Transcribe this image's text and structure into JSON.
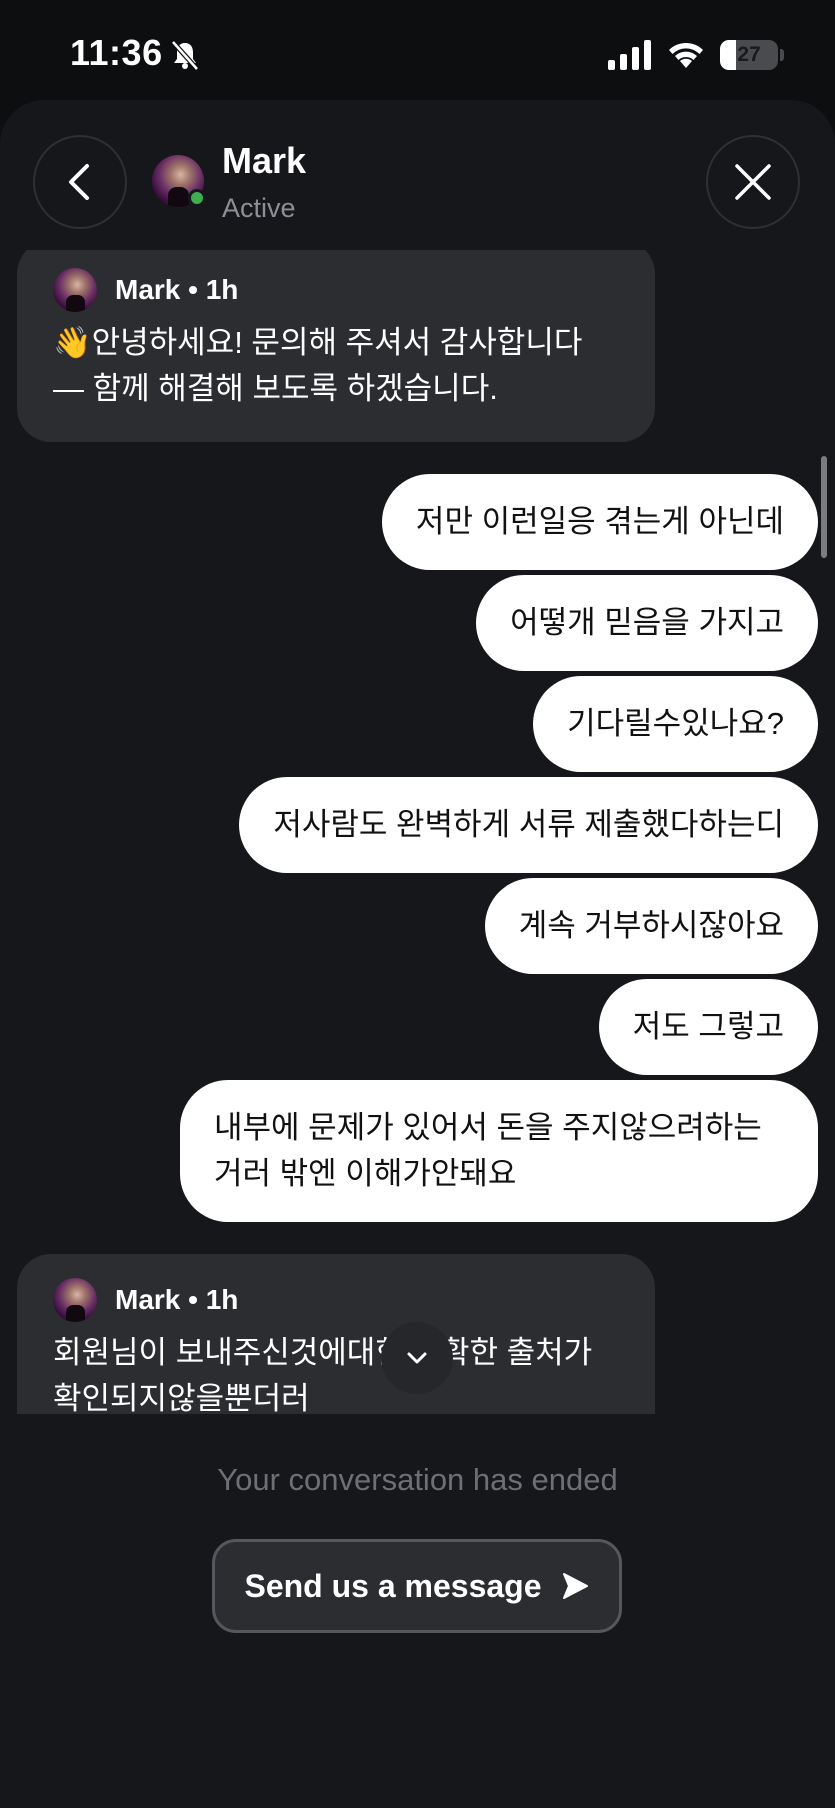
{
  "status_bar": {
    "time": "11:36",
    "battery": "27"
  },
  "header": {
    "name": "Mark",
    "status": "Active"
  },
  "messages": [
    {
      "from": "agent",
      "meta": "Mark • 1h",
      "text": "👋안녕하세요! 문의해 주셔서 감사합니다 — 함께 해결해 보도록 하겠습니다."
    },
    {
      "from": "user",
      "text": "저만 이런일응 겪는게 아닌데"
    },
    {
      "from": "user",
      "text": "어떻개 믿음을 가지고"
    },
    {
      "from": "user",
      "text": "기다릴수있나요?"
    },
    {
      "from": "user",
      "text": "저사람도 완벽하게 서류 제출했다하는디"
    },
    {
      "from": "user",
      "text": "계속 거부하시잖아요"
    },
    {
      "from": "user",
      "text": "저도 그렇고"
    },
    {
      "from": "user",
      "text": "내부에 문제가 있어서 돈을 주지않으려하는 거러 밖엔 이해가안돼요"
    },
    {
      "from": "agent",
      "meta": "Mark • 1h",
      "text": "회원님이 보내주신것에대한 정확한 출처가 확인되지않을뿐더러"
    }
  ],
  "footer": {
    "ended_text": "Your conversation has ended",
    "send_button": "Send us a message"
  },
  "icons": {
    "back": "chevron-left-icon",
    "close": "close-icon",
    "scroll_down": "chevron-down-icon",
    "send": "send-arrow-icon",
    "silent": "bell-slash-icon"
  },
  "colors": {
    "background": "#0d0e10",
    "sheet": "#16171a",
    "agent_bubble": "#2c2d31",
    "user_bubble": "#ffffff",
    "online": "#3fae4f"
  }
}
